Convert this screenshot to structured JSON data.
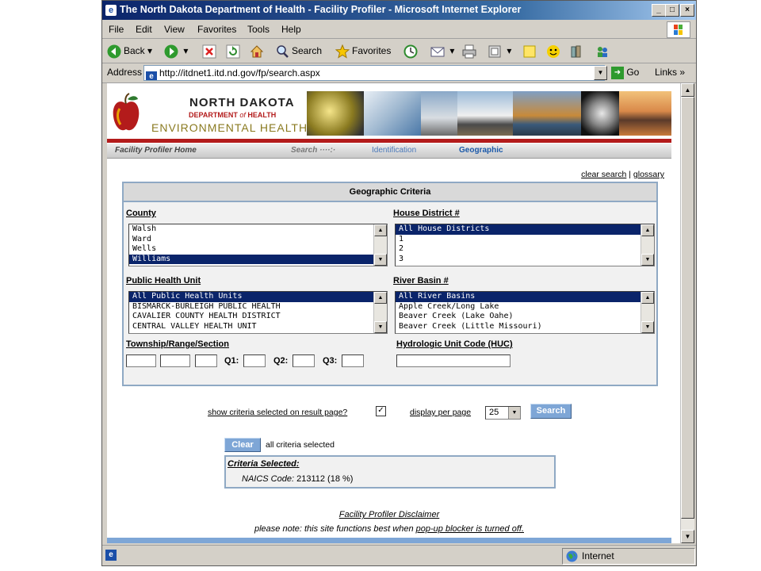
{
  "window": {
    "title": "The North Dakota Department of Health - Facility Profiler - Microsoft Internet Explorer"
  },
  "menu": [
    "File",
    "Edit",
    "View",
    "Favorites",
    "Tools",
    "Help"
  ],
  "toolbar": {
    "back": "Back",
    "search": "Search",
    "favorites": "Favorites"
  },
  "address": {
    "label": "Address",
    "url": "http://itdnet1.itd.nd.gov/fp/search.aspx",
    "go": "Go",
    "links": "Links"
  },
  "banner": {
    "line1": "NORTH DAKOTA",
    "line2a": "DEPARTMENT",
    "line2b": "of",
    "line2c": "HEALTH",
    "line3": "ENVIRONMENTAL HEALTH"
  },
  "nav": {
    "home": "Facility Profiler Home",
    "search": "Search ····:·",
    "identification": "Identification",
    "geographic": "Geographic"
  },
  "links": {
    "clear_search": "clear search",
    "sep": "|",
    "glossary": "glossary"
  },
  "panel": {
    "title": "Geographic Criteria",
    "county": {
      "label": "County",
      "items": [
        "Walsh",
        "Ward",
        "Wells",
        "Williams"
      ],
      "selected": "Williams"
    },
    "house": {
      "label": "House District #",
      "items": [
        "All House Districts",
        "1",
        "2",
        "3"
      ],
      "selected": "All House Districts"
    },
    "phu": {
      "label": "Public Health Unit",
      "items": [
        "All Public Health Units",
        "BISMARCK-BURLEIGH PUBLIC HEALTH",
        "CAVALIER COUNTY HEALTH DISTRICT",
        "CENTRAL VALLEY HEALTH UNIT"
      ],
      "selected": "All Public Health Units"
    },
    "river": {
      "label": "River Basin #",
      "items": [
        "All River Basins",
        "Apple Creek/Long Lake",
        "Beaver Creek (Lake Oahe)",
        "Beaver Creek (Little Missouri)"
      ],
      "selected": "All River Basins"
    },
    "township": {
      "label": "Township/Range/Section",
      "q1": "Q1:",
      "q2": "Q2:",
      "q3": "Q3:"
    },
    "huc": {
      "label": "Hydrologic Unit Code (HUC)"
    }
  },
  "options": {
    "show_criteria": "show criteria selected on result page?",
    "show_criteria_checked": true,
    "display_per_page": "display per page",
    "per_page_value": "25",
    "search_button": "Search"
  },
  "criteria": {
    "clear_button": "Clear",
    "all_selected": "all criteria selected",
    "heading": "Criteria Selected:",
    "naics_label": "NAICS Code:",
    "naics_value": "213112 (18 %)"
  },
  "footer": {
    "disclaimer": "Facility Profiler Disclaimer",
    "note_prefix": "please note: this site functions best when",
    "note_link": "pop-up blocker is turned off."
  },
  "status": {
    "zone": "Internet"
  },
  "colors": {
    "title_bar": "#0a246a",
    "accent_red": "#b31b1b",
    "panel_border": "#8fa9c4",
    "button_blue": "#7ea6d6",
    "selection": "#0a246a"
  }
}
